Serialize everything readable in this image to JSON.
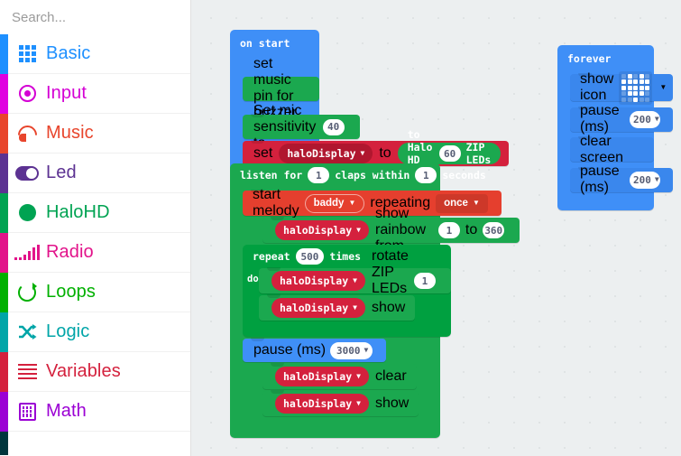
{
  "search": {
    "placeholder": "Search...",
    "value": "",
    "icon": "search-icon"
  },
  "toolbox": {
    "categories": [
      {
        "label": "Basic",
        "color": "#1e90ff",
        "strip": "#1e90ff",
        "icon": "grid-icon"
      },
      {
        "label": "Input",
        "color": "#d400d4",
        "strip": "#e000e0",
        "icon": "target-icon"
      },
      {
        "label": "Music",
        "color": "#e8452c",
        "strip": "#e8452c",
        "icon": "headphones-icon"
      },
      {
        "label": "Led",
        "color": "#5c3292",
        "strip": "#5c3292",
        "icon": "toggle-icon"
      },
      {
        "label": "HaloHD",
        "color": "#00a352",
        "strip": "#00a352",
        "icon": "circle-icon"
      },
      {
        "label": "Radio",
        "color": "#e2138a",
        "strip": "#e2138a",
        "icon": "signal-bars-icon"
      },
      {
        "label": "Loops",
        "color": "#00b000",
        "strip": "#00b000",
        "icon": "loop-arrow-icon"
      },
      {
        "label": "Logic",
        "color": "#00a5a8",
        "strip": "#00a5a8",
        "icon": "shuffle-icon"
      },
      {
        "label": "Variables",
        "color": "#d4213d",
        "strip": "#d4213d",
        "icon": "lines-icon"
      },
      {
        "label": "Math",
        "color": "#9b00d4",
        "strip": "#9b00d4",
        "icon": "calculator-icon"
      }
    ],
    "partial_category": {
      "label": "",
      "strip": "#00363d"
    }
  },
  "canvas": {
    "on_start": {
      "header": "on start",
      "statements": [
        {
          "id": "set-music-pin",
          "text": "set music pin for buzzer",
          "color": "#1ba84f"
        },
        {
          "id": "set-mic-sensitivity",
          "prefix": "Set mic sensitivity to",
          "value": "40",
          "color": "#1ba84f"
        },
        {
          "id": "set-variable",
          "prefix": "set",
          "variable": "haloDisplay",
          "mid": "to",
          "reporter_prefix": "to Halo HD with",
          "reporter_value": "60",
          "reporter_suffix": "ZIP LEDs",
          "color": "#d4213d",
          "reporter_color": "#1ba84f"
        }
      ]
    },
    "listen_block": {
      "header_prefix": "listen for",
      "claps": "1",
      "header_mid": "claps within",
      "seconds": "1",
      "header_suffix": "seconds",
      "statements": [
        {
          "id": "start-melody",
          "prefix": "start melody",
          "melody": "baddy",
          "mid": "repeating",
          "repeat_mode": "once",
          "color": "#e53f2e"
        },
        {
          "id": "show-rainbow",
          "variable": "haloDisplay",
          "prefix": "show rainbow from",
          "from": "1",
          "mid": "to",
          "to": "360",
          "color": "#1ba84f"
        },
        {
          "id": "repeat-loop",
          "prefix": "repeat",
          "times": "500",
          "suffix": "times",
          "do_label": "do",
          "color": "#00a040",
          "body": [
            {
              "id": "rotate-zip",
              "variable": "haloDisplay",
              "prefix": "rotate ZIP LEDs by",
              "value": "1",
              "color": "#1ba84f"
            },
            {
              "id": "halo-show-inner",
              "variable": "haloDisplay",
              "prefix": "show",
              "color": "#1ba84f"
            }
          ]
        },
        {
          "id": "pause-3000",
          "prefix": "pause (ms)",
          "value": "3000",
          "color": "#3f8ff7"
        },
        {
          "id": "halo-clear",
          "variable": "haloDisplay",
          "prefix": "clear",
          "color": "#1ba84f"
        },
        {
          "id": "halo-show",
          "variable": "haloDisplay",
          "prefix": "show",
          "color": "#1ba84f"
        }
      ]
    },
    "forever": {
      "header": "forever",
      "statements": [
        {
          "id": "show-icon",
          "prefix": "show icon",
          "icon": "heart-icon",
          "color": "#3f8ff7"
        },
        {
          "id": "pause-200-a",
          "prefix": "pause (ms)",
          "value": "200",
          "color": "#3f8ff7"
        },
        {
          "id": "clear-screen",
          "prefix": "clear screen",
          "color": "#3f8ff7"
        },
        {
          "id": "pause-200-b",
          "prefix": "pause (ms)",
          "value": "200",
          "color": "#3f8ff7"
        }
      ],
      "heart_pattern": [
        [
          0,
          1,
          0,
          1,
          0
        ],
        [
          1,
          1,
          1,
          1,
          1
        ],
        [
          1,
          1,
          1,
          1,
          1
        ],
        [
          0,
          1,
          1,
          1,
          0
        ],
        [
          0,
          0,
          1,
          0,
          0
        ]
      ]
    }
  }
}
